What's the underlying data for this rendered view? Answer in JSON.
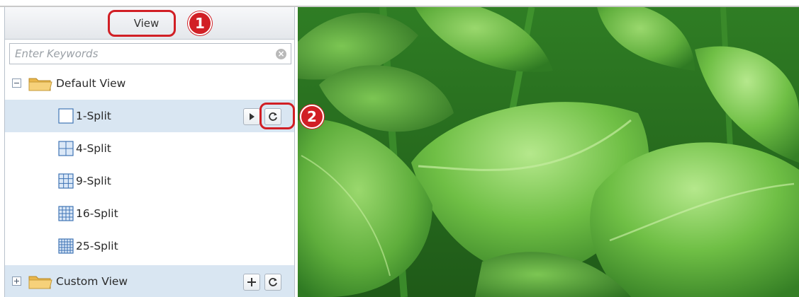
{
  "panel": {
    "view_tab_label": "View",
    "search": {
      "placeholder": "Enter Keywords",
      "value": ""
    },
    "tree": {
      "default_view": {
        "label": "Default View",
        "expanded": true,
        "items": [
          {
            "label": "1-Split",
            "grid": 1,
            "selected": true
          },
          {
            "label": "4-Split",
            "grid": 2,
            "selected": false
          },
          {
            "label": "9-Split",
            "grid": 3,
            "selected": false
          },
          {
            "label": "16-Split",
            "grid": 4,
            "selected": false
          },
          {
            "label": "25-Split",
            "grid": 5,
            "selected": false
          }
        ]
      },
      "custom_view": {
        "label": "Custom View",
        "expanded": false
      }
    }
  },
  "callouts": [
    {
      "number": "1",
      "target": "view-tab"
    },
    {
      "number": "2",
      "target": "refresh-button"
    }
  ],
  "icons": {
    "play": "play-icon",
    "refresh": "refresh-icon",
    "add": "plus-icon",
    "folder": "folder-icon",
    "clear": "clear-search-icon"
  },
  "colors": {
    "accent_red": "#d11f25",
    "selection": "#d9e6f2",
    "grid_icon_blue": "#3f74b5",
    "folder_yellow": "#f3c35a"
  }
}
